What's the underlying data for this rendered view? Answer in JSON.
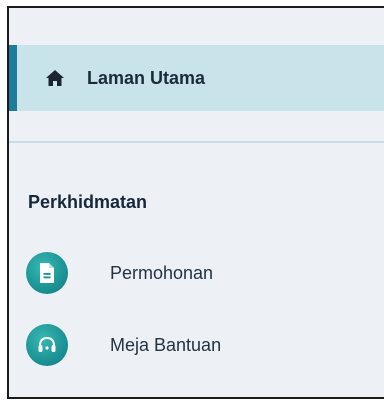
{
  "nav": {
    "home": {
      "label": "Laman Utama",
      "icon": "home-icon"
    }
  },
  "services": {
    "title": "Perkhidmatan",
    "items": [
      {
        "label": "Permohonan",
        "icon": "document-icon"
      },
      {
        "label": "Meja Bantuan",
        "icon": "headset-icon"
      }
    ]
  },
  "colors": {
    "active_bg": "#c9e3ea",
    "active_accent": "#1d7c99",
    "icon_bg": "#1a8f92",
    "panel_bg": "#edf1f5"
  }
}
